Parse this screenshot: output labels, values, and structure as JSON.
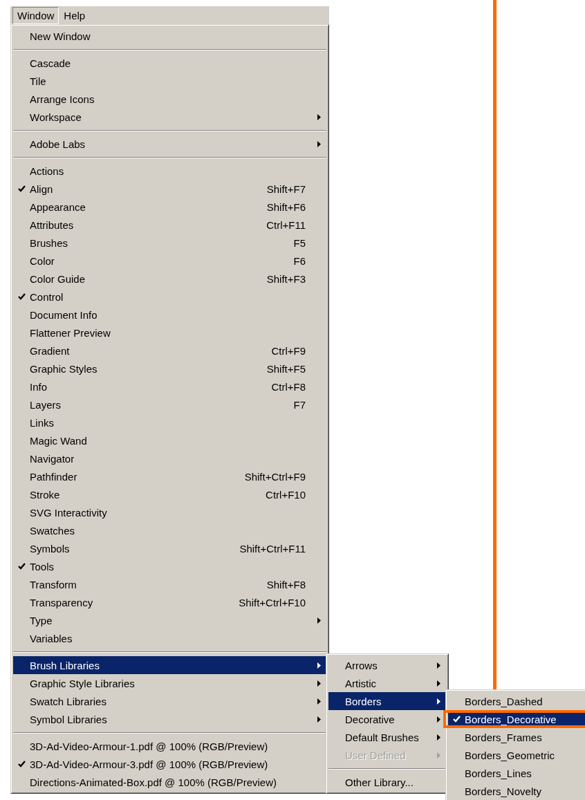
{
  "menu_bar": [
    {
      "label": "Window",
      "selected": true
    },
    {
      "label": "Help",
      "selected": false
    }
  ],
  "window_menu": {
    "groups": [
      {
        "items": [
          {
            "label": "New Window",
            "checked": false,
            "selected": false,
            "has_submenu": false
          }
        ]
      },
      {
        "items": [
          {
            "label": "Cascade",
            "checked": false,
            "selected": false,
            "has_submenu": false
          },
          {
            "label": "Tile",
            "checked": false,
            "selected": false,
            "has_submenu": false
          },
          {
            "label": "Arrange Icons",
            "checked": false,
            "selected": false,
            "has_submenu": false
          },
          {
            "label": "Workspace",
            "checked": false,
            "selected": false,
            "has_submenu": true
          }
        ]
      },
      {
        "items": [
          {
            "label": "Adobe Labs",
            "checked": false,
            "selected": false,
            "has_submenu": true
          }
        ]
      },
      {
        "items": [
          {
            "label": "Actions",
            "checked": false,
            "selected": false,
            "has_submenu": false
          },
          {
            "label": "Align",
            "shortcut": "Shift+F7",
            "checked": true,
            "selected": false,
            "has_submenu": false
          },
          {
            "label": "Appearance",
            "shortcut": "Shift+F6",
            "checked": false,
            "selected": false,
            "has_submenu": false
          },
          {
            "label": "Attributes",
            "shortcut": "Ctrl+F11",
            "checked": false,
            "selected": false,
            "has_submenu": false
          },
          {
            "label": "Brushes",
            "shortcut": "F5",
            "checked": false,
            "selected": false,
            "has_submenu": false
          },
          {
            "label": "Color",
            "shortcut": "F6",
            "checked": false,
            "selected": false,
            "has_submenu": false
          },
          {
            "label": "Color Guide",
            "shortcut": "Shift+F3",
            "checked": false,
            "selected": false,
            "has_submenu": false
          },
          {
            "label": "Control",
            "checked": true,
            "selected": false,
            "has_submenu": false
          },
          {
            "label": "Document Info",
            "checked": false,
            "selected": false,
            "has_submenu": false
          },
          {
            "label": "Flattener Preview",
            "checked": false,
            "selected": false,
            "has_submenu": false
          },
          {
            "label": "Gradient",
            "shortcut": "Ctrl+F9",
            "checked": false,
            "selected": false,
            "has_submenu": false
          },
          {
            "label": "Graphic Styles",
            "shortcut": "Shift+F5",
            "checked": false,
            "selected": false,
            "has_submenu": false
          },
          {
            "label": "Info",
            "shortcut": "Ctrl+F8",
            "checked": false,
            "selected": false,
            "has_submenu": false
          },
          {
            "label": "Layers",
            "shortcut": "F7",
            "checked": false,
            "selected": false,
            "has_submenu": false
          },
          {
            "label": "Links",
            "checked": false,
            "selected": false,
            "has_submenu": false
          },
          {
            "label": "Magic Wand",
            "checked": false,
            "selected": false,
            "has_submenu": false
          },
          {
            "label": "Navigator",
            "checked": false,
            "selected": false,
            "has_submenu": false
          },
          {
            "label": "Pathfinder",
            "shortcut": "Shift+Ctrl+F9",
            "checked": false,
            "selected": false,
            "has_submenu": false
          },
          {
            "label": "Stroke",
            "shortcut": "Ctrl+F10",
            "checked": false,
            "selected": false,
            "has_submenu": false
          },
          {
            "label": "SVG Interactivity",
            "checked": false,
            "selected": false,
            "has_submenu": false
          },
          {
            "label": "Swatches",
            "checked": false,
            "selected": false,
            "has_submenu": false
          },
          {
            "label": "Symbols",
            "shortcut": "Shift+Ctrl+F11",
            "checked": false,
            "selected": false,
            "has_submenu": false
          },
          {
            "label": "Tools",
            "checked": true,
            "selected": false,
            "has_submenu": false
          },
          {
            "label": "Transform",
            "shortcut": "Shift+F8",
            "checked": false,
            "selected": false,
            "has_submenu": false
          },
          {
            "label": "Transparency",
            "shortcut": "Shift+Ctrl+F10",
            "checked": false,
            "selected": false,
            "has_submenu": false
          },
          {
            "label": "Type",
            "checked": false,
            "selected": false,
            "has_submenu": true
          },
          {
            "label": "Variables",
            "checked": false,
            "selected": false,
            "has_submenu": false
          }
        ]
      },
      {
        "items": [
          {
            "label": "Brush Libraries",
            "checked": false,
            "selected": true,
            "has_submenu": true
          },
          {
            "label": "Graphic Style Libraries",
            "checked": false,
            "selected": false,
            "has_submenu": true
          },
          {
            "label": "Swatch Libraries",
            "checked": false,
            "selected": false,
            "has_submenu": true
          },
          {
            "label": "Symbol Libraries",
            "checked": false,
            "selected": false,
            "has_submenu": true
          }
        ]
      },
      {
        "items": [
          {
            "label": "3D-Ad-Video-Armour-1.pdf @ 100% (RGB/Preview)",
            "checked": false,
            "selected": false,
            "has_submenu": false
          },
          {
            "label": "3D-Ad-Video-Armour-3.pdf @ 100% (RGB/Preview)",
            "checked": true,
            "selected": false,
            "has_submenu": false
          },
          {
            "label": "Directions-Animated-Box.pdf @ 100% (RGB/Preview)",
            "checked": false,
            "selected": false,
            "has_submenu": false
          }
        ]
      }
    ]
  },
  "brush_libraries_menu": {
    "groups": [
      {
        "items": [
          {
            "label": "Arrows",
            "checked": false,
            "selected": false,
            "disabled": false,
            "has_submenu": true
          },
          {
            "label": "Artistic",
            "checked": false,
            "selected": false,
            "disabled": false,
            "has_submenu": true
          },
          {
            "label": "Borders",
            "checked": false,
            "selected": true,
            "disabled": false,
            "has_submenu": true
          },
          {
            "label": "Decorative",
            "checked": false,
            "selected": false,
            "disabled": false,
            "has_submenu": true
          },
          {
            "label": "Default Brushes",
            "checked": false,
            "selected": false,
            "disabled": false,
            "has_submenu": true
          },
          {
            "label": "User Defined",
            "checked": false,
            "selected": false,
            "disabled": true,
            "has_submenu": true
          }
        ]
      },
      {
        "items": [
          {
            "label": "Other Library...",
            "checked": false,
            "selected": false,
            "disabled": false,
            "has_submenu": false
          }
        ]
      }
    ]
  },
  "borders_menu": {
    "groups": [
      {
        "items": [
          {
            "label": "Borders_Dashed",
            "checked": false,
            "selected": false
          },
          {
            "label": "Borders_Decorative",
            "checked": true,
            "selected": true
          },
          {
            "label": "Borders_Frames",
            "checked": false,
            "selected": false
          },
          {
            "label": "Borders_Geometric",
            "checked": false,
            "selected": false
          },
          {
            "label": "Borders_Lines",
            "checked": false,
            "selected": false
          },
          {
            "label": "Borders_Novelty",
            "checked": false,
            "selected": false
          }
        ]
      }
    ]
  }
}
